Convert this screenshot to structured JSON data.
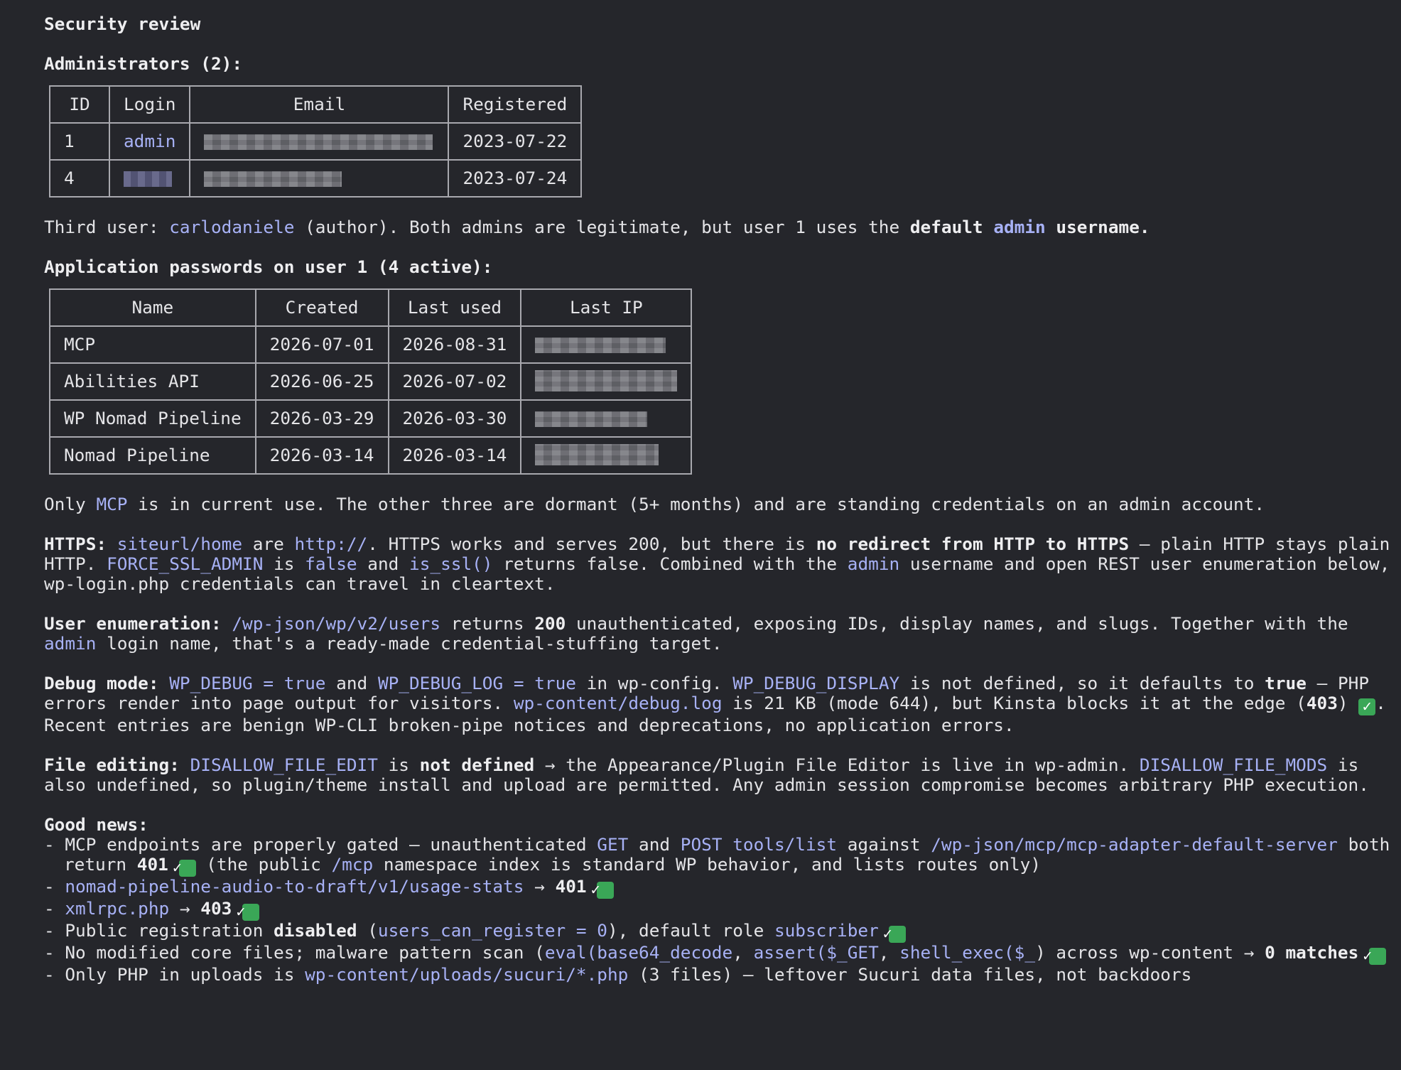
{
  "title": "Security review",
  "admins": {
    "heading": "Administrators (2):",
    "columns": [
      "ID",
      "Login",
      "Email",
      "Registered"
    ],
    "rows": [
      {
        "id": "1",
        "login": "admin",
        "registered": "2023-07-22"
      },
      {
        "id": "4",
        "login": "",
        "registered": "2023-07-24"
      }
    ]
  },
  "third_user": {
    "pre": "Third user: ",
    "name": "carlodaniele",
    "mid": " (author). Both admins are legitimate, but user 1 uses the ",
    "b1": "default ",
    "code": "admin",
    "b2": " username."
  },
  "app_passwords": {
    "heading": "Application passwords on user 1 (4 active):",
    "columns": [
      "Name",
      "Created",
      "Last used",
      "Last IP"
    ],
    "rows": [
      {
        "name": "MCP",
        "created": "2026-07-01",
        "last_used": "2026-08-31"
      },
      {
        "name": "Abilities API",
        "created": "2026-06-25",
        "last_used": "2026-07-02"
      },
      {
        "name": "WP Nomad Pipeline",
        "created": "2026-03-29",
        "last_used": "2026-03-30"
      },
      {
        "name": "Nomad Pipeline",
        "created": "2026-03-14",
        "last_used": "2026-03-14"
      }
    ]
  },
  "only_mcp": {
    "pre": "Only ",
    "code": "MCP",
    "post": " is in current use. The other three are dormant (5+ months) and are standing credentials on an admin account."
  },
  "https": {
    "label": "HTTPS:",
    "s1": " ",
    "c1": "siteurl/home",
    "s2": " are ",
    "c2": "http://",
    "s3": ". HTTPS works and serves 200, but there is ",
    "b1": "no redirect from HTTP to HTTPS",
    "s4": " — plain HTTP stays plain HTTP. ",
    "c3": "FORCE_SSL_ADMIN",
    "s5": " is ",
    "c4": "false",
    "s6": " and ",
    "c5": "is_ssl()",
    "s7": " returns false. Combined with the ",
    "c6": "admin",
    "s8": " username and open REST user enumeration below, wp-login.php credentials can travel in cleartext."
  },
  "enum": {
    "label": "User enumeration:",
    "s1": " ",
    "c1": "/wp-json/wp/v2/users",
    "s2": " returns ",
    "b1": "200",
    "s3": " unauthenticated, exposing IDs, display names, and slugs. Together with the ",
    "c2": "admin",
    "s4": " login name, that's a ready-made credential-stuffing target."
  },
  "debug": {
    "label": "Debug mode:",
    "s1": " ",
    "c1": "WP_DEBUG = true",
    "s2": " and ",
    "c2": "WP_DEBUG_LOG = true",
    "s3": " in wp-config. ",
    "c3": "WP_DEBUG_DISPLAY",
    "s4": " is not defined, so it defaults to ",
    "b1": "true",
    "s5": " — PHP errors render into page output for visitors. ",
    "c4": "wp-content/debug.log",
    "s6": " is 21 KB (mode 644), but Kinsta blocks it at the edge (",
    "b2": "403",
    "s7": ") ",
    "ok": "✓",
    "s8": ". Recent entries are benign WP-CLI broken-pipe notices and deprecations, no application errors."
  },
  "file_edit": {
    "label": "File editing:",
    "s1": " ",
    "c1": "DISALLOW_FILE_EDIT",
    "s2": " is ",
    "b1": "not defined",
    "s3": " → the Appearance/Plugin File Editor is live in wp-admin. ",
    "c2": "DISALLOW_FILE_MODS",
    "s4": " is also undefined, so plugin/theme install and upload are permitted. Any admin session compromise becomes arbitrary PHP execution."
  },
  "good_news": {
    "label": "Good news:",
    "ok": "✓",
    "i1": {
      "s1": "- MCP endpoints are properly gated — unauthenticated ",
      "c1": "GET",
      "s2": " and ",
      "c2": "POST tools/list",
      "s3": " against ",
      "c3": "/wp-json/mcp/mcp-adapter-default-server",
      "s4": " both return ",
      "b1": "401",
      "s5": " (the public ",
      "c4": "/mcp",
      "s6": " namespace index is standard WP behavior, and lists routes only)"
    },
    "i2": {
      "s1": "- ",
      "c1": "nomad-pipeline-audio-to-draft/v1/usage-stats",
      "s2": " → ",
      "b1": "401"
    },
    "i3": {
      "s1": "- ",
      "c1": "xmlrpc.php",
      "s2": " → ",
      "b1": "403"
    },
    "i4": {
      "s1": "- Public registration ",
      "b1": "disabled",
      "s2": " (",
      "c1": "users_can_register = 0",
      "s3": "), default role ",
      "c2": "subscriber"
    },
    "i5": {
      "s1": "- No modified core files; malware pattern scan (",
      "c1": "eval(base64_decode",
      "s2": ", ",
      "c2": "assert($_GET",
      "s3": ", ",
      "c3": "shell_exec($_",
      "s4": ") across wp-content → ",
      "b1": "0 matches"
    },
    "i6": {
      "s1": "- Only PHP in uploads is ",
      "c1": "wp-content/uploads/sucuri/*.php",
      "s2": " (3 files) — leftover Sucuri data files, not backdoors"
    }
  },
  "colors": {
    "background": "#25262b",
    "text": "#e4e4e7",
    "code": "#a7b1f5",
    "check": "#3aa757"
  }
}
